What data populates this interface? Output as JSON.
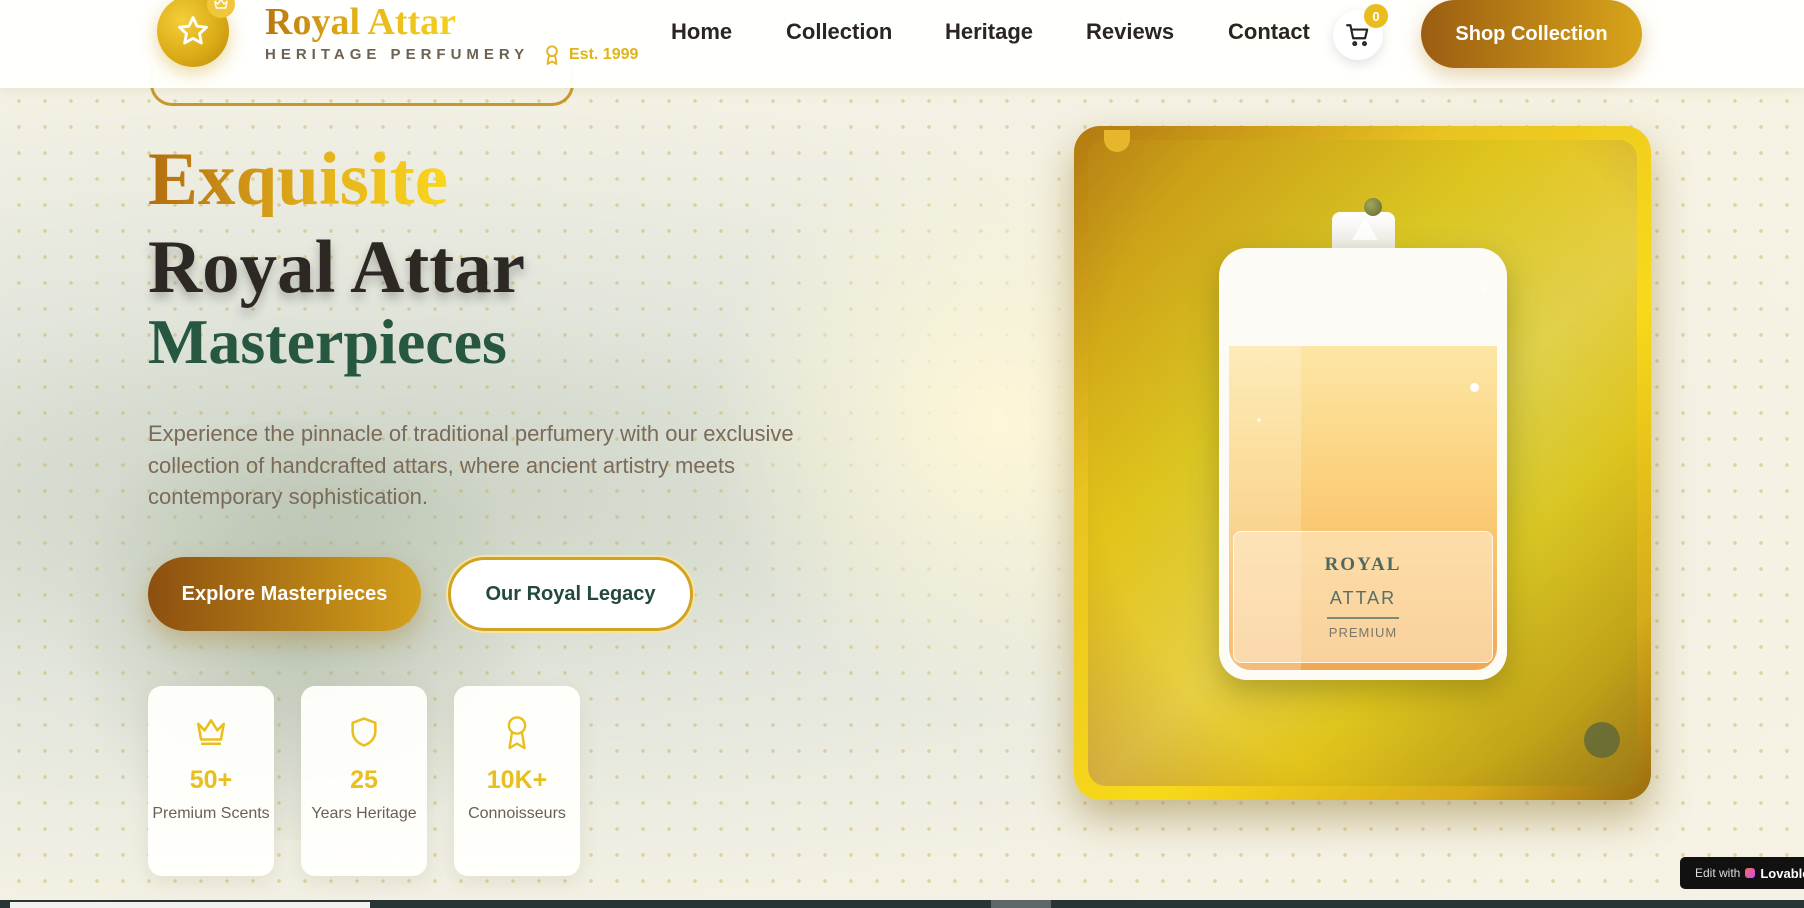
{
  "brand": {
    "name": "Royal Attar",
    "subtitle": "HERITAGE PERFUMERY",
    "established": "Est. 1999"
  },
  "nav": {
    "items": [
      {
        "label": "Home"
      },
      {
        "label": "Collection"
      },
      {
        "label": "Heritage"
      },
      {
        "label": "Reviews"
      },
      {
        "label": "Contact"
      }
    ],
    "cart_count": "0",
    "shop_label": "Shop Collection"
  },
  "hero": {
    "line1": "Exquisite",
    "line2": "Royal Attar",
    "line3": "Masterpieces",
    "description": "Experience the pinnacle of traditional perfumery with our exclusive collection of handcrafted attars, where ancient artistry meets contemporary sophistication.",
    "primary_button": "Explore Masterpieces",
    "secondary_button": "Our Royal Legacy"
  },
  "stats": [
    {
      "icon": "crown-icon",
      "value": "50+",
      "label": "Premium Scents"
    },
    {
      "icon": "shield-icon",
      "value": "25",
      "label": "Years Heritage"
    },
    {
      "icon": "award-icon",
      "value": "10K+",
      "label": "Connoisseurs"
    }
  ],
  "product": {
    "label_line1": "ROYAL",
    "label_line2": "ATTAR",
    "label_line3": "PREMIUM"
  },
  "badge": {
    "prefix": "Edit with",
    "brand": "Lovable"
  },
  "colors": {
    "gold": "#e0b418",
    "brown": "#9b5d12",
    "green": "#275740",
    "dark": "#2d2824"
  }
}
